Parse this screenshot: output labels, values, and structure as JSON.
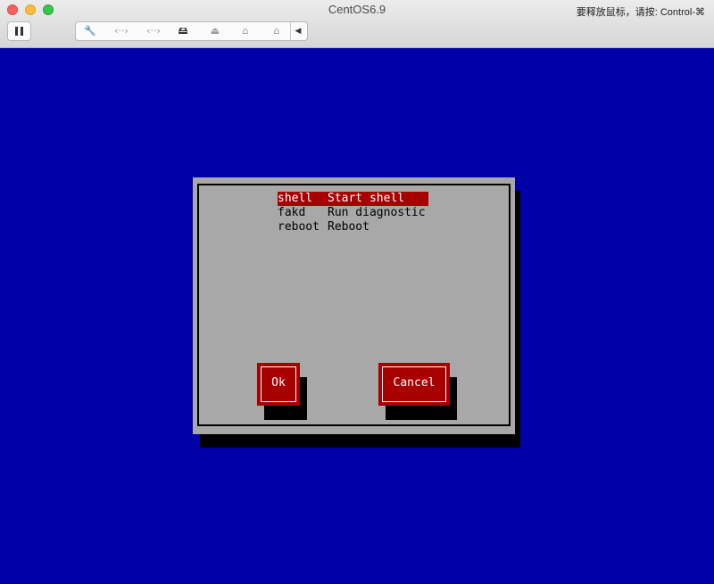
{
  "window": {
    "title": "CentOS6.9",
    "release_hint": "要释放鼠标，请按: Control-⌘"
  },
  "toolbar": {
    "icons": [
      "pause-icon",
      "wrench-icon",
      "network-adapter-icon",
      "network-adapter-icon",
      "hard-disk-icon",
      "optical-drive-icon",
      "usb-icon",
      "usb-icon",
      "collapse-arrow-icon"
    ],
    "glyphs": {
      "pause": "",
      "wrench": "🔧",
      "net": "‹··›",
      "disk": "🖴",
      "cd": "⏏",
      "usb": "⌂",
      "collapse": "◀"
    }
  },
  "colors": {
    "console_background": "#0000a8",
    "dialog_background": "#a8a8a8",
    "selection": "#a80000",
    "button": "#a80000"
  },
  "dialog": {
    "menu_items": [
      {
        "command": "shell",
        "description": "Start shell",
        "selected": true
      },
      {
        "command": "fakd",
        "description": "Run diagnostic",
        "selected": false
      },
      {
        "command": "reboot",
        "description": "Reboot",
        "selected": false
      }
    ],
    "buttons": {
      "ok": "Ok",
      "cancel": "Cancel"
    }
  }
}
